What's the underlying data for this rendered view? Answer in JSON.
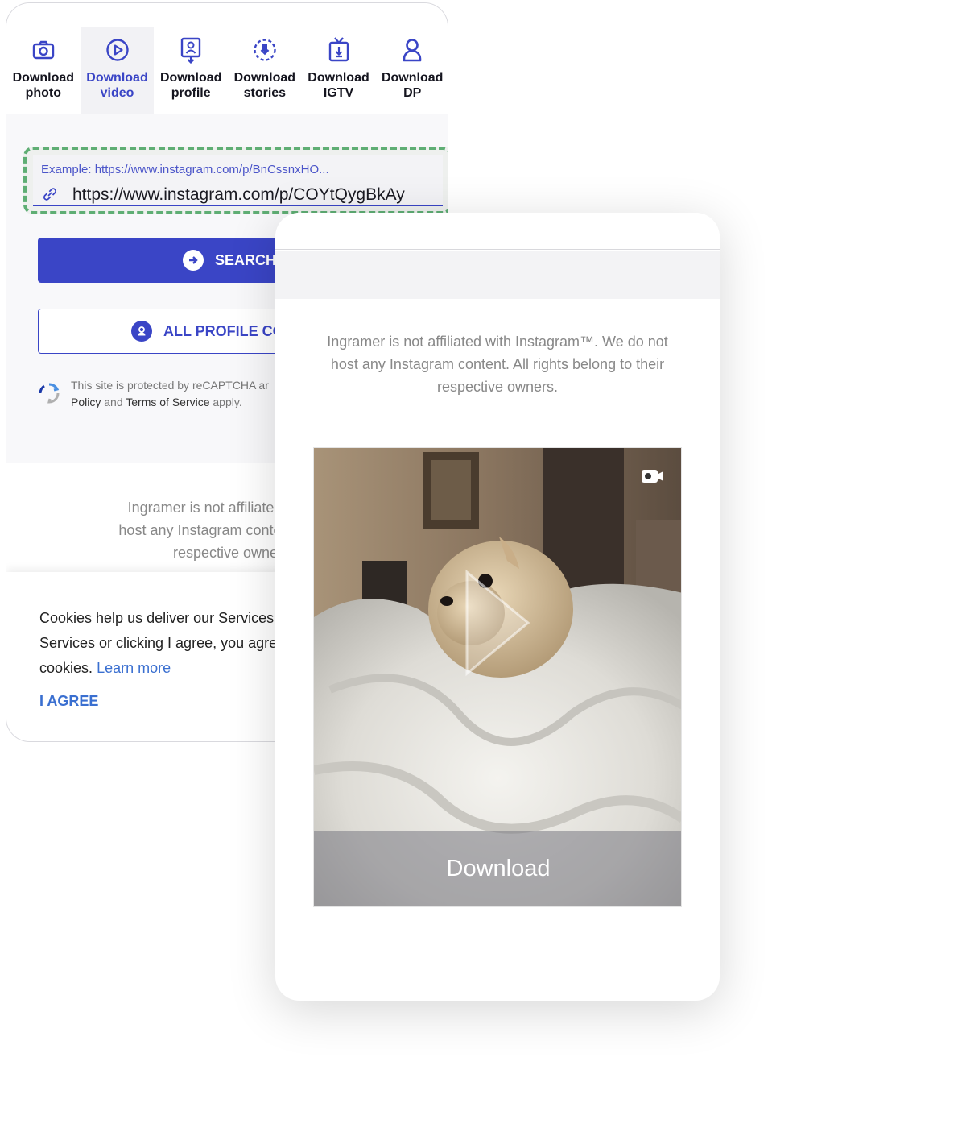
{
  "tabs": [
    {
      "label": "Download\nphoto",
      "icon": "camera-icon",
      "active": false
    },
    {
      "label": "Download\nvideo",
      "icon": "play-circle-icon",
      "active": true
    },
    {
      "label": "Download\nprofile",
      "icon": "profile-icon",
      "active": false
    },
    {
      "label": "Download\nstories",
      "icon": "stories-icon",
      "active": false
    },
    {
      "label": "Download\nIGTV",
      "icon": "tv-icon",
      "active": false
    },
    {
      "label": "Download\nDP",
      "icon": "person-icon",
      "active": false
    }
  ],
  "url": {
    "placeholder": "Example: https://www.instagram.com/p/BnCssnxHO...",
    "value": "https://www.instagram.com/p/COYtQygBkAy"
  },
  "buttons": {
    "search": "SEARCH",
    "profile": "ALL PROFILE CO"
  },
  "recaptcha": {
    "line1": "This site is protected by reCAPTCHA ar",
    "policy": "Policy",
    "and": " and ",
    "terms": "Terms of Service",
    "apply": " apply."
  },
  "disclaimer_back": {
    "line1": "Ingramer is not affiliated with In",
    "line2": "host any Instagram content. All rig",
    "line3": "respective owner"
  },
  "cookie": {
    "line1": "Cookies help us deliver our Services",
    "line2": "Services or clicking I agree, you agre",
    "line3": "cookies.",
    "learn_more": "Learn more",
    "agree": "I AGREE"
  },
  "front": {
    "disclaimer": "Ingramer is not affiliated with Instagram™. We do not host any Instagram content. All rights belong to their respective owners.",
    "download": "Download"
  },
  "colors": {
    "accent": "#3a45c6",
    "dashed_border": "#5fae74",
    "link": "#3a6fd0"
  }
}
